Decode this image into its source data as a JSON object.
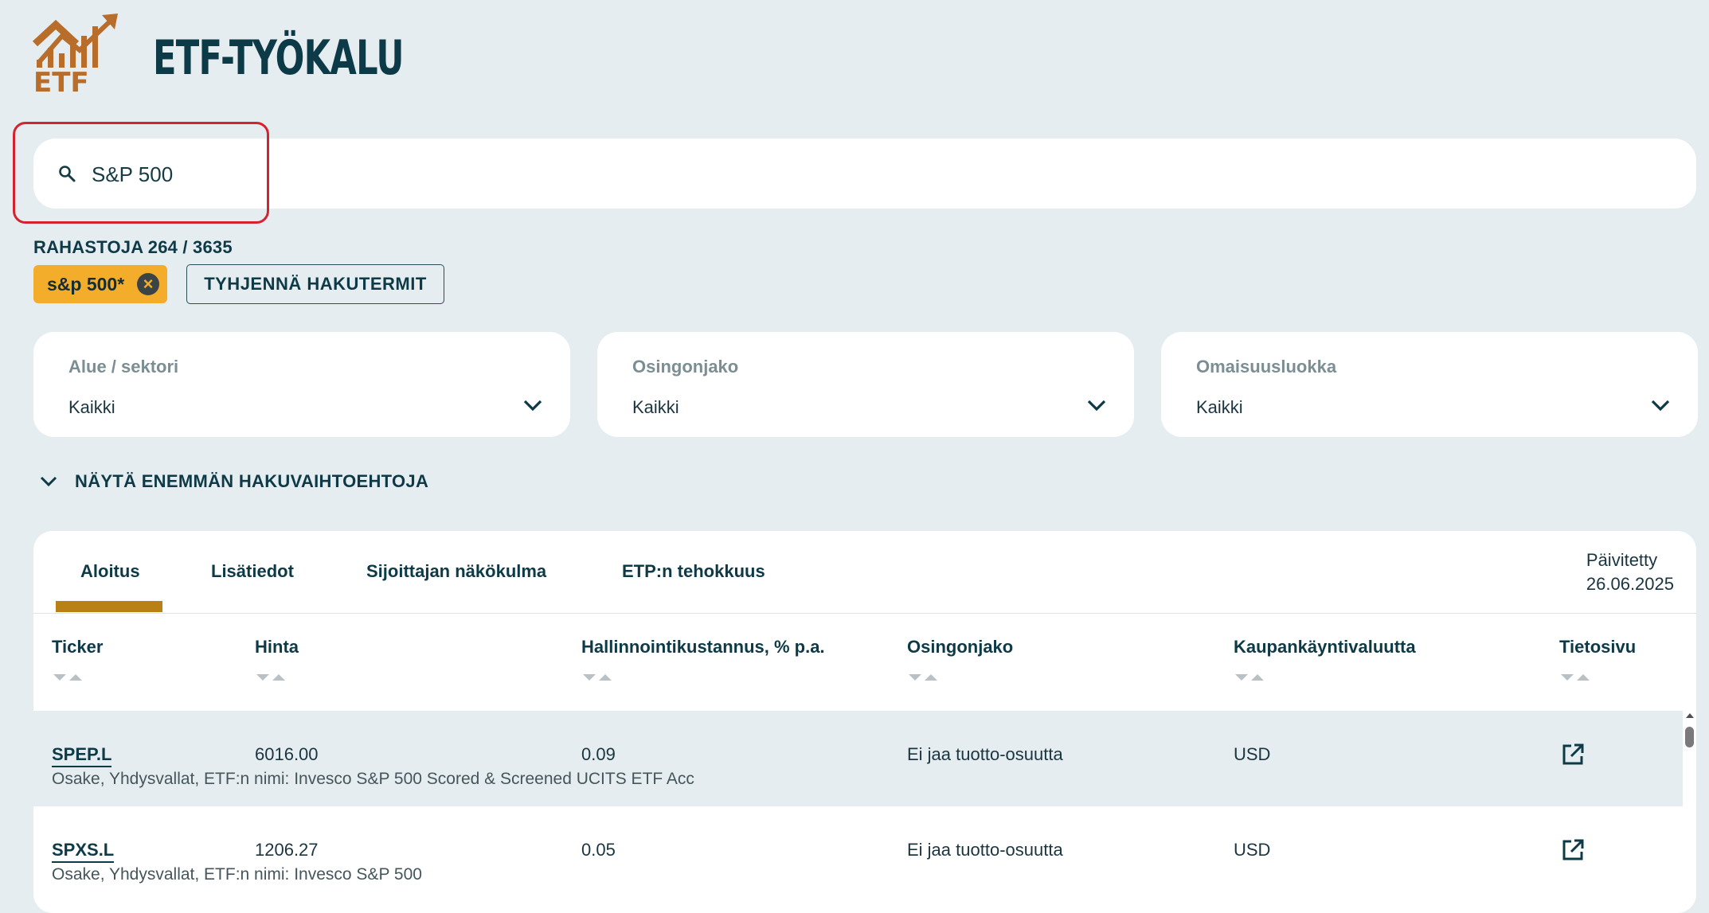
{
  "app": {
    "title": "ETF-TYÖKALU",
    "logo_text": "ETF",
    "colors": {
      "brand": "#b86d2b",
      "accent": "#f3ad2b",
      "primary_text": "#0e3a47",
      "highlight": "#d3232f"
    }
  },
  "search": {
    "value": "S&P 500",
    "icon": "search-icon"
  },
  "results": {
    "count_text": "RAHASTOJA 264 / 3635"
  },
  "chips": [
    {
      "label": "s&p 500*",
      "remove_symbol": "×"
    }
  ],
  "clear_button": {
    "label": "TYHJENNÄ HAKUTERMIT"
  },
  "filters": [
    {
      "label": "Alue / sektori",
      "value": "Kaikki"
    },
    {
      "label": "Osingonjako",
      "value": "Kaikki"
    },
    {
      "label": "Omaisuusluokka",
      "value": "Kaikki"
    }
  ],
  "more_options": {
    "label": "NÄYTÄ ENEMMÄN HAKUVAIHTOEHTOJA"
  },
  "tabs": [
    {
      "label": "Aloitus",
      "active": true
    },
    {
      "label": "Lisätiedot"
    },
    {
      "label": "Sijoittajan näkökulma"
    },
    {
      "label": "ETP:n tehokkuus"
    }
  ],
  "updated": {
    "label": "Päivitetty",
    "date": "26.06.2025"
  },
  "table": {
    "columns": [
      "Ticker",
      "Hinta",
      "Hallinnointikustannus, % p.a.",
      "Osingonjako",
      "Kaupankäyntivaluutta",
      "Tietosivu"
    ],
    "rows": [
      {
        "ticker": "SPEP.L",
        "price": "6016.00",
        "fee": "0.09",
        "dividend": "Ei jaa tuotto-osuutta",
        "currency": "USD",
        "description": "Osake, Yhdysvallat, ETF:n nimi: Invesco S&P 500 Scored & Screened UCITS ETF Acc"
      },
      {
        "ticker": "SPXS.L",
        "price": "1206.27",
        "fee": "0.05",
        "dividend": "Ei jaa tuotto-osuutta",
        "currency": "USD",
        "description": "Osake, Yhdysvallat, ETF:n nimi: Invesco S&P 500"
      }
    ]
  }
}
